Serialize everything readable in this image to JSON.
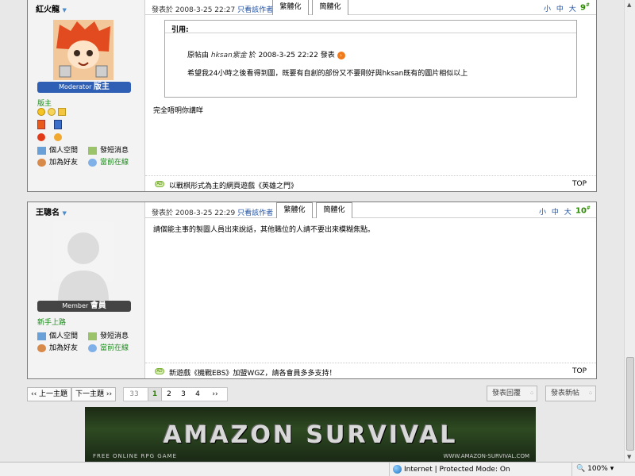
{
  "browser": {
    "zone": "Internet | Protected Mode: On",
    "zoom": "100%"
  },
  "posts": [
    {
      "username": "紅火龍",
      "rank_bar_prefix": "Moderator",
      "rank_bar_title": "版主",
      "rank_title": "版主",
      "time": "發表於 2008-3-25 22:27",
      "only_author": "只看該作者",
      "tab_trad": "繁體化",
      "tab_simp": "簡體化",
      "sizes": "小 中 大",
      "floor": "9",
      "floor_suffix": "#",
      "quote_header": "引用:",
      "quote_by_prefix": "原帖由",
      "quote_author": "hksan紫金",
      "quote_by_mid": "於 2008-3-25 22:22 發表",
      "quote_text": "希望我24小時之後看得到圖，既要有自創的部份又不要剛好與hksan既有的圖片相似以上",
      "body": "完全唔明你講咩",
      "space": "個人空間",
      "pm": "發短消息",
      "friend": "加為好友",
      "online": "當前在線",
      "ad_badge": "AD",
      "ad": "以戰棋形式為主的網頁遊戲《英雄之門》",
      "top": "TOP"
    },
    {
      "username": "王聰名",
      "rank_bar_prefix": "Member",
      "rank_bar_title": "會員",
      "rank_title": "新手上路",
      "time": "發表於 2008-3-25 22:29",
      "only_author": "只看該作者",
      "tab_trad": "繁體化",
      "tab_simp": "簡體化",
      "sizes": "小 中 大",
      "floor": "10",
      "floor_suffix": "#",
      "body": "請個能主事的製圖人員出來說話，其他職位的人請不要出來模糊焦點。",
      "space": "個人空間",
      "pm": "發短消息",
      "friend": "加為好友",
      "online": "當前在線",
      "ad_badge": "AD",
      "ad": "新遊戲《機戰EBS》加盟WGZ，請各會員多多支持！",
      "top": "TOP"
    }
  ],
  "nav": {
    "prev": "‹‹ 上一主題",
    "next": "下一主題 ››"
  },
  "pages": {
    "first": "33",
    "current": "1",
    "p2": "2",
    "p3": "3",
    "p4": "4",
    "more": "››"
  },
  "reply_btn": "發表回覆",
  "new_btn": "發表新帖",
  "banner": {
    "title": "AMAZON SURVIVAL",
    "left": "FREE ONLINE RPG GAME",
    "right": "WWW.AMAZON-SURVIVAL.COM"
  },
  "colors": {
    "moderator_bar": "#2f5fb4",
    "member_bar": "#444444",
    "accent_green": "#2b8a00",
    "link_blue": "#1d4fa2"
  }
}
